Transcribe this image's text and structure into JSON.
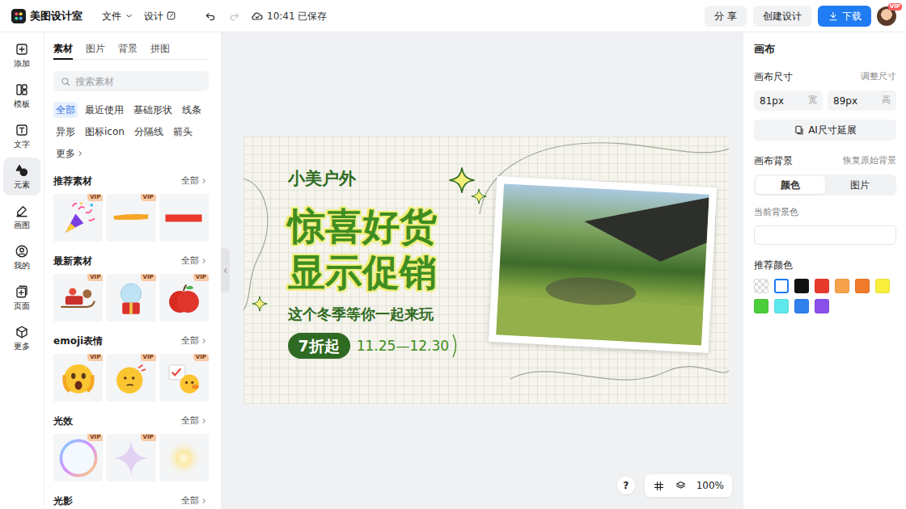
{
  "topbar": {
    "brand": "美图设计室",
    "file_menu": "文件",
    "design_menu": "设计",
    "save_status": "10:41 已保存",
    "redo_disabled": true,
    "share": "分 享",
    "create": "创建设计",
    "download": "下载",
    "avatar_badge": "VIP"
  },
  "rail": [
    {
      "label": "添加",
      "selected": false
    },
    {
      "label": "模板",
      "selected": false
    },
    {
      "label": "文字",
      "selected": false
    },
    {
      "label": "元素",
      "selected": true
    },
    {
      "label": "画图",
      "selected": false
    },
    {
      "label": "我的",
      "selected": false
    },
    {
      "label": "页面",
      "selected": false
    },
    {
      "label": "更多",
      "selected": false
    }
  ],
  "panel": {
    "tabs": [
      {
        "label": "素材",
        "selected": true
      },
      {
        "label": "图片",
        "selected": false
      },
      {
        "label": "背景",
        "selected": false
      },
      {
        "label": "拼图",
        "selected": false
      }
    ],
    "search": {
      "placeholder": "搜索素材"
    },
    "filters": [
      {
        "label": "全部",
        "selected": true
      },
      {
        "label": "最近使用",
        "selected": false
      },
      {
        "label": "基础形状",
        "selected": false
      },
      {
        "label": "线条",
        "selected": false
      },
      {
        "label": "异形",
        "selected": false
      },
      {
        "label": "图标icon",
        "selected": false
      },
      {
        "label": "分隔线",
        "selected": false
      },
      {
        "label": "箭头",
        "selected": false
      }
    ],
    "more_filter": "更多",
    "vip_label": "VIP",
    "sections": [
      {
        "title": "推荐素材",
        "all": "全部",
        "items": [
          {
            "kind": "popper",
            "vip": true
          },
          {
            "kind": "brush",
            "vip": true
          },
          {
            "kind": "bar",
            "vip": false
          }
        ]
      },
      {
        "title": "最新素材",
        "all": "全部",
        "items": [
          {
            "kind": "sleigh",
            "vip": true
          },
          {
            "kind": "globe",
            "vip": true
          },
          {
            "kind": "apple",
            "vip": true
          }
        ]
      },
      {
        "title": "emoji表情",
        "all": "全部",
        "items": [
          {
            "kind": "scared",
            "vip": true
          },
          {
            "kind": "think",
            "vip": true
          },
          {
            "kind": "sign",
            "vip": true
          }
        ]
      },
      {
        "title": "光效",
        "all": "全部",
        "items": [
          {
            "kind": "bubble",
            "vip": true
          },
          {
            "kind": "sparkle",
            "vip": true
          },
          {
            "kind": "glow",
            "vip": false
          }
        ]
      },
      {
        "title": "光影",
        "all": "全部",
        "items": [
          {
            "kind": "shadegrey",
            "vip": false
          },
          {
            "kind": "shadewhite",
            "vip": false
          },
          {
            "kind": "shadeorange",
            "vip": true
          }
        ]
      }
    ]
  },
  "design": {
    "brand": "小美户外",
    "headline": [
      "惊喜好货",
      "显示促销"
    ],
    "subline": "这个冬季等你一起来玩",
    "discount": "7折起",
    "dates": "11.25—12.30"
  },
  "view": {
    "help": "?",
    "zoom": "100%"
  },
  "inspector": {
    "title": "画布",
    "size_label": "画布尺寸",
    "resize": "调整尺寸",
    "width": {
      "value": "81px",
      "unit": "宽"
    },
    "height": {
      "value": "89px",
      "unit": "高"
    },
    "ai_extend": "AI尺寸延展",
    "bg_label": "画布背景",
    "restore": "恢复原始背景",
    "bg_tabs": [
      {
        "label": "颜色",
        "selected": true
      },
      {
        "label": "图片",
        "selected": false
      }
    ],
    "current_bg_label": "当前背景色",
    "current_bg_color": "#ffffff",
    "recommend_label": "推荐颜色",
    "swatches": [
      {
        "kind": "transparent",
        "selected": false
      },
      {
        "kind": "solid",
        "color": "#ffffff",
        "selected": true
      },
      {
        "kind": "solid",
        "color": "#111111",
        "selected": false
      },
      {
        "kind": "solid",
        "color": "#e83a2c",
        "selected": false
      },
      {
        "kind": "solid",
        "color": "#f5a24a",
        "selected": false
      },
      {
        "kind": "solid",
        "color": "#ef7b2a",
        "selected": false
      },
      {
        "kind": "solid",
        "color": "#f7ef3a",
        "selected": false
      },
      {
        "kind": "solid",
        "color": "#4ccd3c",
        "selected": false
      },
      {
        "kind": "solid",
        "color": "#5ee8ec",
        "selected": false
      },
      {
        "kind": "solid",
        "color": "#2f80ed",
        "selected": false
      },
      {
        "kind": "solid",
        "color": "#8a4fe8",
        "selected": false
      }
    ]
  }
}
